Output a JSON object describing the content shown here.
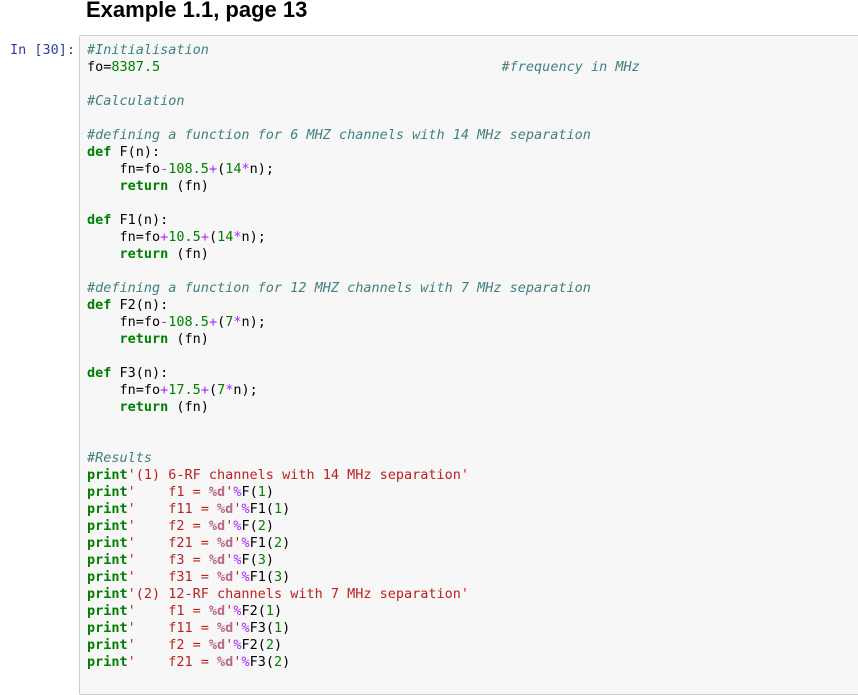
{
  "heading": "Example 1.1, page 13",
  "cell": {
    "prompt": "In [30]:",
    "lines": [
      [
        {
          "t": "c",
          "v": "#Initialisation"
        }
      ],
      [
        {
          "t": "p",
          "v": "fo="
        },
        {
          "t": "n",
          "v": "8387.5"
        },
        {
          "t": "p",
          "v": "                                          "
        },
        {
          "t": "c",
          "v": "#frequency in MHz"
        }
      ],
      [],
      [
        {
          "t": "c",
          "v": "#Calculation"
        }
      ],
      [],
      [
        {
          "t": "c",
          "v": "#defining a function for 6 MHZ channels with 14 MHz separation"
        }
      ],
      [
        {
          "t": "k",
          "v": "def"
        },
        {
          "t": "p",
          "v": " F(n):"
        }
      ],
      [
        {
          "t": "p",
          "v": "    fn=fo"
        },
        {
          "t": "o",
          "v": "-"
        },
        {
          "t": "n",
          "v": "108.5"
        },
        {
          "t": "o",
          "v": "+"
        },
        {
          "t": "p",
          "v": "("
        },
        {
          "t": "n",
          "v": "14"
        },
        {
          "t": "o",
          "v": "*"
        },
        {
          "t": "p",
          "v": "n);"
        }
      ],
      [
        {
          "t": "p",
          "v": "    "
        },
        {
          "t": "k",
          "v": "return"
        },
        {
          "t": "p",
          "v": " (fn)"
        }
      ],
      [],
      [
        {
          "t": "k",
          "v": "def"
        },
        {
          "t": "p",
          "v": " F1(n):"
        }
      ],
      [
        {
          "t": "p",
          "v": "    fn=fo"
        },
        {
          "t": "o",
          "v": "+"
        },
        {
          "t": "n",
          "v": "10.5"
        },
        {
          "t": "o",
          "v": "+"
        },
        {
          "t": "p",
          "v": "("
        },
        {
          "t": "n",
          "v": "14"
        },
        {
          "t": "o",
          "v": "*"
        },
        {
          "t": "p",
          "v": "n);"
        }
      ],
      [
        {
          "t": "p",
          "v": "    "
        },
        {
          "t": "k",
          "v": "return"
        },
        {
          "t": "p",
          "v": " (fn)"
        }
      ],
      [],
      [
        {
          "t": "c",
          "v": "#defining a function for 12 MHZ channels with 7 MHz separation"
        }
      ],
      [
        {
          "t": "k",
          "v": "def"
        },
        {
          "t": "p",
          "v": " F2(n):"
        }
      ],
      [
        {
          "t": "p",
          "v": "    fn=fo"
        },
        {
          "t": "o",
          "v": "-"
        },
        {
          "t": "n",
          "v": "108.5"
        },
        {
          "t": "o",
          "v": "+"
        },
        {
          "t": "p",
          "v": "("
        },
        {
          "t": "n",
          "v": "7"
        },
        {
          "t": "o",
          "v": "*"
        },
        {
          "t": "p",
          "v": "n);"
        }
      ],
      [
        {
          "t": "p",
          "v": "    "
        },
        {
          "t": "k",
          "v": "return"
        },
        {
          "t": "p",
          "v": " (fn)"
        }
      ],
      [],
      [
        {
          "t": "k",
          "v": "def"
        },
        {
          "t": "p",
          "v": " F3(n):"
        }
      ],
      [
        {
          "t": "p",
          "v": "    fn=fo"
        },
        {
          "t": "o",
          "v": "+"
        },
        {
          "t": "n",
          "v": "17.5"
        },
        {
          "t": "o",
          "v": "+"
        },
        {
          "t": "p",
          "v": "("
        },
        {
          "t": "n",
          "v": "7"
        },
        {
          "t": "o",
          "v": "*"
        },
        {
          "t": "p",
          "v": "n);"
        }
      ],
      [
        {
          "t": "p",
          "v": "    "
        },
        {
          "t": "k",
          "v": "return"
        },
        {
          "t": "p",
          "v": " (fn)"
        }
      ],
      [],
      [],
      [
        {
          "t": "c",
          "v": "#Results"
        }
      ],
      [
        {
          "t": "k",
          "v": "print"
        },
        {
          "t": "s",
          "v": "'(1) 6-RF channels with 14 MHz separation'"
        }
      ],
      [
        {
          "t": "k",
          "v": "print"
        },
        {
          "t": "s",
          "v": "'    f1 = "
        },
        {
          "t": "si",
          "v": "%d"
        },
        {
          "t": "s",
          "v": "'"
        },
        {
          "t": "o",
          "v": "%"
        },
        {
          "t": "p",
          "v": "F("
        },
        {
          "t": "n",
          "v": "1"
        },
        {
          "t": "p",
          "v": ")"
        }
      ],
      [
        {
          "t": "k",
          "v": "print"
        },
        {
          "t": "s",
          "v": "'    f11 = "
        },
        {
          "t": "si",
          "v": "%d"
        },
        {
          "t": "s",
          "v": "'"
        },
        {
          "t": "o",
          "v": "%"
        },
        {
          "t": "p",
          "v": "F1("
        },
        {
          "t": "n",
          "v": "1"
        },
        {
          "t": "p",
          "v": ")"
        }
      ],
      [
        {
          "t": "k",
          "v": "print"
        },
        {
          "t": "s",
          "v": "'    f2 = "
        },
        {
          "t": "si",
          "v": "%d"
        },
        {
          "t": "s",
          "v": "'"
        },
        {
          "t": "o",
          "v": "%"
        },
        {
          "t": "p",
          "v": "F("
        },
        {
          "t": "n",
          "v": "2"
        },
        {
          "t": "p",
          "v": ")"
        }
      ],
      [
        {
          "t": "k",
          "v": "print"
        },
        {
          "t": "s",
          "v": "'    f21 = "
        },
        {
          "t": "si",
          "v": "%d"
        },
        {
          "t": "s",
          "v": "'"
        },
        {
          "t": "o",
          "v": "%"
        },
        {
          "t": "p",
          "v": "F1("
        },
        {
          "t": "n",
          "v": "2"
        },
        {
          "t": "p",
          "v": ")"
        }
      ],
      [
        {
          "t": "k",
          "v": "print"
        },
        {
          "t": "s",
          "v": "'    f3 = "
        },
        {
          "t": "si",
          "v": "%d"
        },
        {
          "t": "s",
          "v": "'"
        },
        {
          "t": "o",
          "v": "%"
        },
        {
          "t": "p",
          "v": "F("
        },
        {
          "t": "n",
          "v": "3"
        },
        {
          "t": "p",
          "v": ")"
        }
      ],
      [
        {
          "t": "k",
          "v": "print"
        },
        {
          "t": "s",
          "v": "'    f31 = "
        },
        {
          "t": "si",
          "v": "%d"
        },
        {
          "t": "s",
          "v": "'"
        },
        {
          "t": "o",
          "v": "%"
        },
        {
          "t": "p",
          "v": "F1("
        },
        {
          "t": "n",
          "v": "3"
        },
        {
          "t": "p",
          "v": ")"
        }
      ],
      [
        {
          "t": "k",
          "v": "print"
        },
        {
          "t": "s",
          "v": "'(2) 12-RF channels with 7 MHz separation'"
        }
      ],
      [
        {
          "t": "k",
          "v": "print"
        },
        {
          "t": "s",
          "v": "'    f1 = "
        },
        {
          "t": "si",
          "v": "%d"
        },
        {
          "t": "s",
          "v": "'"
        },
        {
          "t": "o",
          "v": "%"
        },
        {
          "t": "p",
          "v": "F2("
        },
        {
          "t": "n",
          "v": "1"
        },
        {
          "t": "p",
          "v": ")"
        }
      ],
      [
        {
          "t": "k",
          "v": "print"
        },
        {
          "t": "s",
          "v": "'    f11 = "
        },
        {
          "t": "si",
          "v": "%d"
        },
        {
          "t": "s",
          "v": "'"
        },
        {
          "t": "o",
          "v": "%"
        },
        {
          "t": "p",
          "v": "F3("
        },
        {
          "t": "n",
          "v": "1"
        },
        {
          "t": "p",
          "v": ")"
        }
      ],
      [
        {
          "t": "k",
          "v": "print"
        },
        {
          "t": "s",
          "v": "'    f2 = "
        },
        {
          "t": "si",
          "v": "%d"
        },
        {
          "t": "s",
          "v": "'"
        },
        {
          "t": "o",
          "v": "%"
        },
        {
          "t": "p",
          "v": "F2("
        },
        {
          "t": "n",
          "v": "2"
        },
        {
          "t": "p",
          "v": ")"
        }
      ],
      [
        {
          "t": "k",
          "v": "print"
        },
        {
          "t": "s",
          "v": "'    f21 = "
        },
        {
          "t": "si",
          "v": "%d"
        },
        {
          "t": "s",
          "v": "'"
        },
        {
          "t": "o",
          "v": "%"
        },
        {
          "t": "p",
          "v": "F3("
        },
        {
          "t": "n",
          "v": "2"
        },
        {
          "t": "p",
          "v": ")"
        }
      ]
    ]
  },
  "colors": {
    "comment": "#408080",
    "keyword": "#008000",
    "string": "#BA2121",
    "number": "#008000",
    "operator": "#AA22FF",
    "prompt": "#303F9F",
    "cell_background": "#f7f7f7",
    "cell_border": "#cfcfcf"
  }
}
